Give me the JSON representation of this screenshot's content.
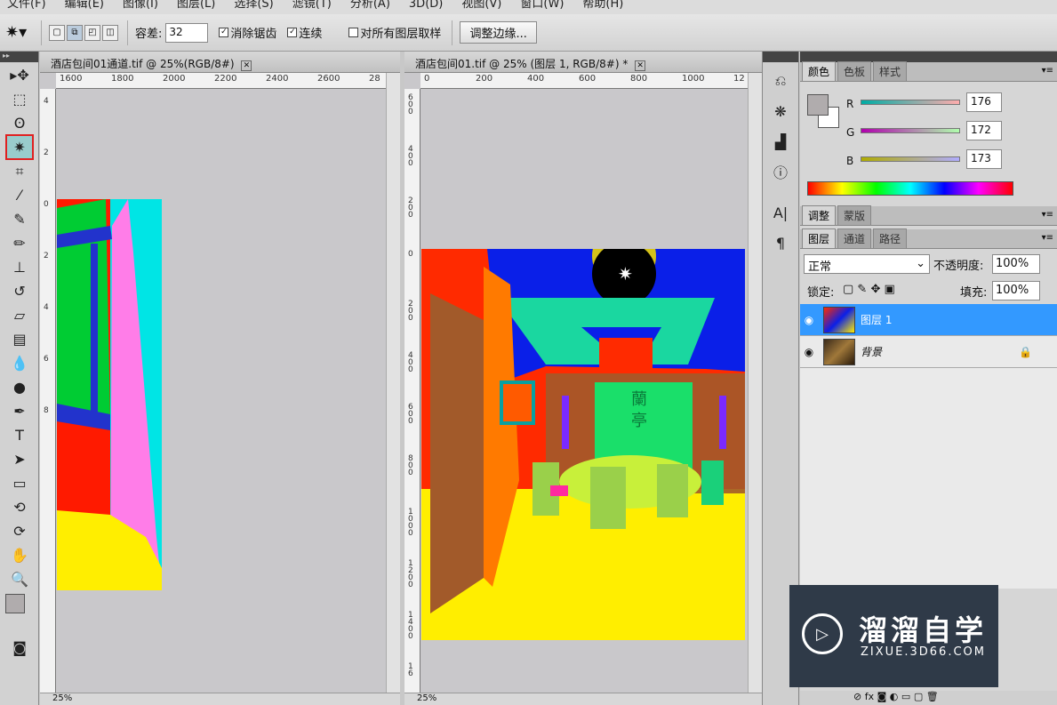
{
  "menu": [
    "文件(F)",
    "编辑(E)",
    "图像(I)",
    "图层(L)",
    "选择(S)",
    "滤镜(T)",
    "分析(A)",
    "3D(D)",
    "视图(V)",
    "窗口(W)",
    "帮助(H)"
  ],
  "options": {
    "tolerance_label": "容差:",
    "tolerance_value": "32",
    "antialias_label": "消除锯齿",
    "contiguous_label": "连续",
    "all_layers_label": "对所有图层取样",
    "refine_edge_label": "调整边缘..."
  },
  "doc_left": {
    "title": "酒店包间01通道.tif @ 25%(RGB/8#)",
    "ruler_h": [
      "1600",
      "1800",
      "2000",
      "2200",
      "2400",
      "2600",
      "28"
    ],
    "ruler_v": [
      "4",
      "2",
      "0",
      "2",
      "4",
      "6",
      "8"
    ],
    "zoom": "25%"
  },
  "doc_right": {
    "title": "酒店包间01.tif @ 25% (图层 1, RGB/8#) *",
    "ruler_h": [
      "0",
      "200",
      "400",
      "600",
      "800",
      "1000",
      "12"
    ],
    "ruler_v": [
      "600",
      "400",
      "200",
      "0",
      "200",
      "400",
      "600",
      "800",
      "1000",
      "1200",
      "1400",
      "16"
    ],
    "zoom": "25%",
    "scene_sign": "蘭亭"
  },
  "color_panel": {
    "tabs": [
      "颜色",
      "色板",
      "样式"
    ],
    "r_label": "R",
    "g_label": "G",
    "b_label": "B",
    "r": "176",
    "g": "172",
    "b": "173"
  },
  "adjust_panel": {
    "tabs": [
      "调整",
      "蒙版"
    ]
  },
  "layers_panel": {
    "tabs": [
      "图层",
      "通道",
      "路径"
    ],
    "blend_mode": "正常",
    "opacity_label": "不透明度:",
    "opacity": "100%",
    "lock_label": "锁定:",
    "fill_label": "填充:",
    "fill": "100%",
    "layers": [
      {
        "name": "图层 1",
        "selected": true
      },
      {
        "name": "背景",
        "selected": false
      }
    ]
  },
  "watermark": {
    "title": "溜溜自学",
    "subtitle": "ZIXUE.3D66.COM"
  },
  "colors": {
    "accent": "#3399ff",
    "selection_red": "#e02020"
  }
}
